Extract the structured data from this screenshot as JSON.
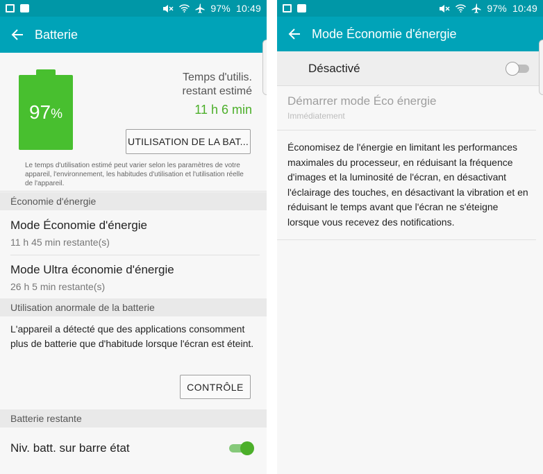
{
  "left": {
    "status": {
      "battery": "97%",
      "time": "10:49"
    },
    "appbar": {
      "title": "Batterie"
    },
    "battery": {
      "level_percent": 97,
      "percent_number": "97",
      "percent_sign": "%",
      "time_label": "Temps d'utilis. restant estimé",
      "time_value": "11 h 6 min",
      "usage_button": "UTILISATION DE LA BAT...",
      "note": "Le temps d'utilisation estimé peut varier selon les paramètres de votre appareil, l'environnement, les habitudes d'utilisation et l'utilisation réelle de l'appareil."
    },
    "power_saving": {
      "header": "Économie d'énergie",
      "items": [
        {
          "title": "Mode Économie d'énergie",
          "subtitle": "11 h 45 min restante(s)"
        },
        {
          "title": "Mode Ultra économie d'énergie",
          "subtitle": "26 h 5 min restante(s)"
        }
      ]
    },
    "abnormal": {
      "header": "Utilisation anormale de la batterie",
      "text": "L'appareil a détecté que des applications consomment plus de batterie que d'habitude lorsque l'écran est éteint.",
      "button": "CONTRÔLE"
    },
    "remaining": {
      "header": "Batterie restante",
      "status_bar_item": "Niv. batt. sur barre état",
      "status_bar_toggle": true
    }
  },
  "right": {
    "status": {
      "battery": "97%",
      "time": "10:49"
    },
    "appbar": {
      "title": "Mode Économie d'énergie"
    },
    "master_switch": {
      "label": "Désactivé",
      "on": false
    },
    "start_mode": {
      "title": "Démarrer mode Éco énergie",
      "subtitle": "Immédiatement"
    },
    "description": "Économisez de l'énergie en limitant les performances maximales du processeur, en réduisant la fréquence d'images et la luminosité de l'écran, en désactivant l'éclairage des touches, en désactivant la vibration et en réduisant le temps avant que l'écran ne s'éteigne lorsque vous recevez des notifications."
  },
  "colors": {
    "status_bar": "#0097a7",
    "app_bar": "#00a3b8",
    "battery_green": "#48bf2f",
    "time_green": "#4caf2a"
  },
  "icons": [
    "gallery-icon",
    "bag-icon",
    "mute-icon",
    "wifi-icon",
    "airplane-icon",
    "back-arrow-icon"
  ]
}
